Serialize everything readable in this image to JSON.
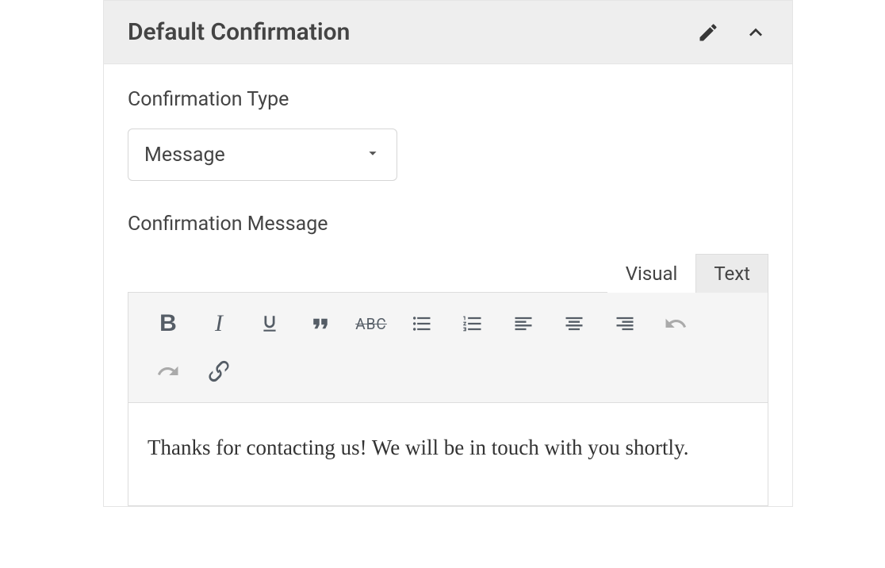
{
  "panel": {
    "title": "Default Confirmation"
  },
  "fields": {
    "type_label": "Confirmation Type",
    "type_value": "Message",
    "message_label": "Confirmation Message",
    "message_value": "Thanks for contacting us! We will be in touch with you shortly."
  },
  "editor": {
    "tabs": {
      "visual": "Visual",
      "text": "Text",
      "active": "text"
    },
    "toolbar": {
      "bold": "B",
      "italic": "I",
      "strike": "ABC"
    }
  }
}
